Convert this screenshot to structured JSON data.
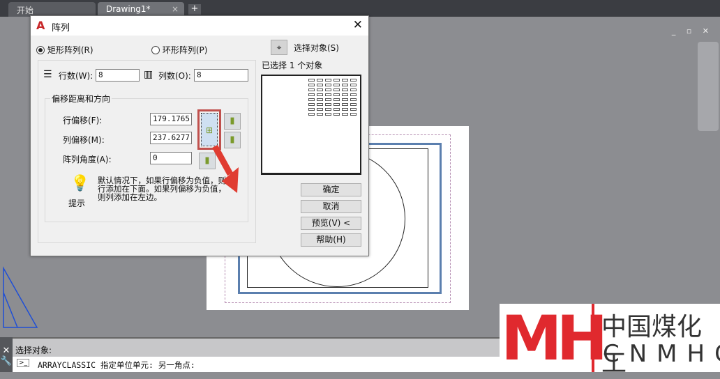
{
  "tabs": [
    {
      "label": "开始"
    },
    {
      "label": "Drawing1*",
      "close": "×"
    }
  ],
  "new_tab": "+",
  "window_controls": "_ ▫ ✕",
  "dialog": {
    "logo": "A",
    "title": "阵列",
    "close": "✕",
    "rect_array": "矩形阵列(R)",
    "polar_array": "环形阵列(P)",
    "rows_label": "行数(W):",
    "rows_value": "8",
    "cols_label": "列数(O):",
    "cols_value": "8",
    "offset_group": "偏移距离和方向",
    "row_offset_label": "行偏移(F):",
    "row_offset_value": "179.1765",
    "col_offset_label": "列偏移(M):",
    "col_offset_value": "237.6277",
    "angle_label": "阵列角度(A):",
    "angle_value": "0",
    "tip_label": "提示",
    "tip_text": "默认情况下，如果行偏移为负值，则行添加在下面。如果列偏移为负值，则列添加在左边。",
    "select_objects": "选择对象(S)",
    "selected_count": "已选择 1 个对象",
    "ok": "确定",
    "cancel": "取消",
    "preview": "预览(V) <",
    "help": "帮助(H)"
  },
  "command": {
    "history": "选择对象:",
    "prompt_icon": ">_",
    "current": "ARRAYCLASSIC 指定单位单元:  另一角点:"
  },
  "watermark": {
    "logo": "MH",
    "cn": "中国煤化工",
    "en": "CNMHG"
  },
  "colors": {
    "highlight": "#c0504d",
    "blue_rect": "#5b7fae",
    "arrow": "#e03c31"
  }
}
